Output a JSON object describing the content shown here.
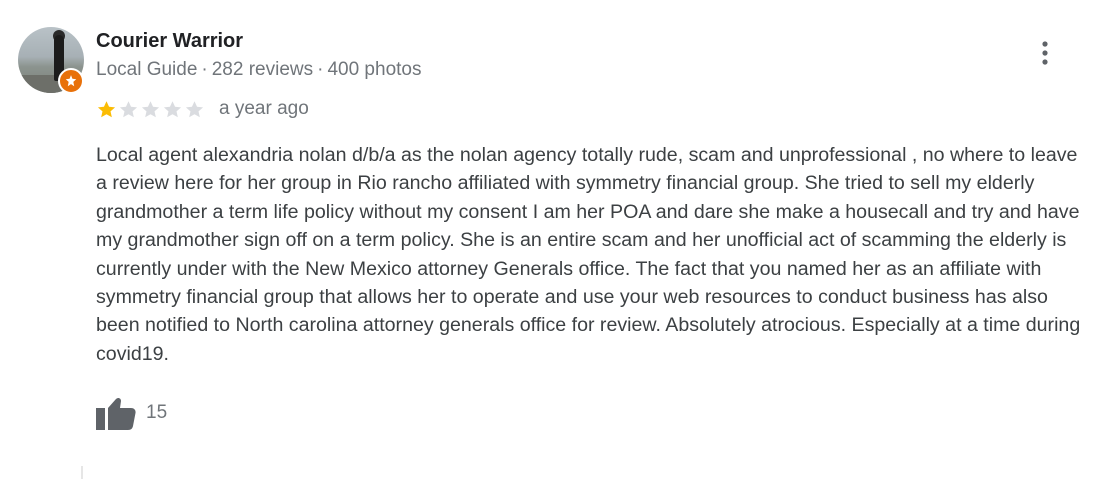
{
  "author": {
    "name": "Courier Warrior",
    "badge": "Local Guide",
    "reviews": "282 reviews",
    "photos": "400 photos",
    "separator": "·"
  },
  "rating": {
    "stars": 1,
    "max_stars": 5,
    "filled_color": "#fbbc04",
    "empty_color": "#dadce0",
    "date": "a year ago"
  },
  "review": {
    "text": "Local agent alexandria nolan d/b/a as the nolan agency totally rude, scam and unprofessional , no where to leave a review here for her group in Rio rancho affiliated with symmetry financial group. She tried to sell my elderly grandmother a term life policy without my consent I am her POA and dare she make a housecall and try and have my grandmother sign off on a term policy. She is an entire scam and her unofficial act of scamming the elderly is currently under with the New Mexico attorney Generals office. The fact that you named her as an affiliate with symmetry financial group that allows her to operate and use your web resources to conduct business has also been notified to North carolina attorney generals office for review. Absolutely atrocious. Especially at a time during covid19."
  },
  "likes": {
    "count": "15",
    "icon": "thumbs-up-icon"
  },
  "icons": {
    "more": "more-vert-icon",
    "guide_badge": "local-guide-badge-icon"
  },
  "colors": {
    "guide_badge": "#e8710a",
    "icon_gray": "#5f6368"
  }
}
